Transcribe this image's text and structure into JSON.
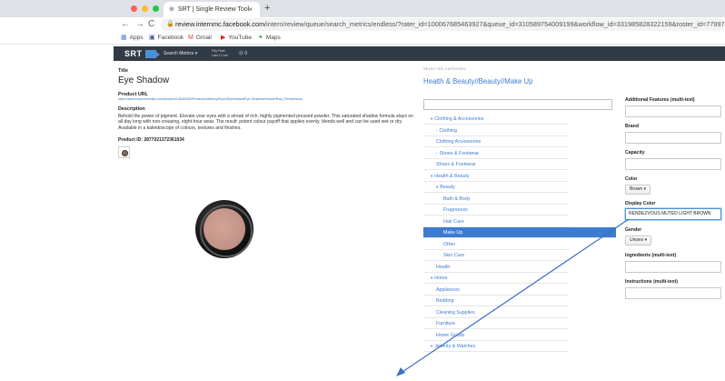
{
  "browser": {
    "tab_title": "SRT | Single Review Tool",
    "tab_close": "×",
    "new_tab": "+",
    "url_host": "review.internmc.facebook.com",
    "url_path": "/intern/review/queue/search_metrics/endless/?rater_id=100067685463927&queue_id=310589754009199&workflow_id=331985828322159&roster_id=7799729931",
    "nav_back": "←",
    "nav_forward": "→",
    "nav_reload": "C",
    "bookmarks": [
      "Apps",
      "Facebook",
      "Gmail",
      "YouTube",
      "Maps"
    ]
  },
  "app_header": {
    "logo": "SRT",
    "menu": "Search Metrics ▾",
    "rate_line1": "Pay Rate",
    "rate_line2": "Last 12 hrs",
    "count": "⓪ 0"
  },
  "product": {
    "title_label": "Title",
    "title": "Eye Shadow",
    "url_label": "Product URL",
    "url": "https://www.maccosmetics.com/product/13840/360/Products/Makeup/Eyes/Eyeshadow/Eye-Shadow#/shade/Rojo_Rendezvous",
    "description_label": "Description",
    "description": "Behold the power of pigment. Elevate your eyes with a streak of rich, highly pigmented pressed powder. This saturated shadow formula stays on all day long with non-creasing, eight-hour wear. The result: potent colour payoff that applies evenly, blends well and can be used wet or dry. Available in a kaleidoscope of colours, textures and finishes.",
    "product_id_label": "Product ID:",
    "product_id": "2877021372361034"
  },
  "category": {
    "label": "SELECTED CATEGORY",
    "path": "Health & Beauty//Beauty//Make Up",
    "tree": [
      {
        "label": "Clothing & Accessories",
        "caret": "▾",
        "indent": 1,
        "selected": false
      },
      {
        "label": "Clothing",
        "caret": "›",
        "indent": 2,
        "selected": false
      },
      {
        "label": "Clothing Accessories",
        "caret": "",
        "indent": 2,
        "selected": false
      },
      {
        "label": "Shoes & Footwear",
        "caret": "›",
        "indent": 2,
        "selected": false
      },
      {
        "label": "Shoes & Footwear",
        "caret": "",
        "indent": 2,
        "selected": false
      },
      {
        "label": "Health & Beauty",
        "caret": "▾",
        "indent": 1,
        "selected": false
      },
      {
        "label": "Beauty",
        "caret": "▾",
        "indent": 2,
        "selected": false
      },
      {
        "label": "Bath & Body",
        "caret": "",
        "indent": 3,
        "selected": false
      },
      {
        "label": "Fragrances",
        "caret": "",
        "indent": 3,
        "selected": false
      },
      {
        "label": "Hair Care",
        "caret": "",
        "indent": 3,
        "selected": false
      },
      {
        "label": "Make Up",
        "caret": "",
        "indent": 3,
        "selected": true
      },
      {
        "label": "Other",
        "caret": "",
        "indent": 3,
        "selected": false
      },
      {
        "label": "Skin Care",
        "caret": "",
        "indent": 3,
        "selected": false
      },
      {
        "label": "Health",
        "caret": "",
        "indent": 2,
        "selected": false
      },
      {
        "label": "Home",
        "caret": "▾",
        "indent": 1,
        "selected": false
      },
      {
        "label": "Appliances",
        "caret": "",
        "indent": 2,
        "selected": false
      },
      {
        "label": "Bedding",
        "caret": "",
        "indent": 2,
        "selected": false
      },
      {
        "label": "Cleaning Supplies",
        "caret": "",
        "indent": 2,
        "selected": false
      },
      {
        "label": "Furniture",
        "caret": "",
        "indent": 2,
        "selected": false
      },
      {
        "label": "Home Goods",
        "caret": "",
        "indent": 2,
        "selected": false
      },
      {
        "label": "Jewelry & Watches",
        "caret": "▾",
        "indent": 1,
        "selected": false
      }
    ]
  },
  "attributes": {
    "additional_features": "Additional Features (multi-text)",
    "brand": "Brand",
    "capacity": "Capacity",
    "color": "Color",
    "color_value": "Brown ▾",
    "display_color": "Display Color",
    "display_color_value": "RENDEZVOUS MUTED LIGHT BROWN",
    "gender": "Gender",
    "gender_value": "Unisex ▾",
    "ingredients": "Ingredients (multi-text)",
    "instructions": "Instructions (multi-text)"
  },
  "colors": {
    "accent": "#3d7bd1",
    "header_bg": "#323a45",
    "arrow": "#3d6fc4"
  }
}
